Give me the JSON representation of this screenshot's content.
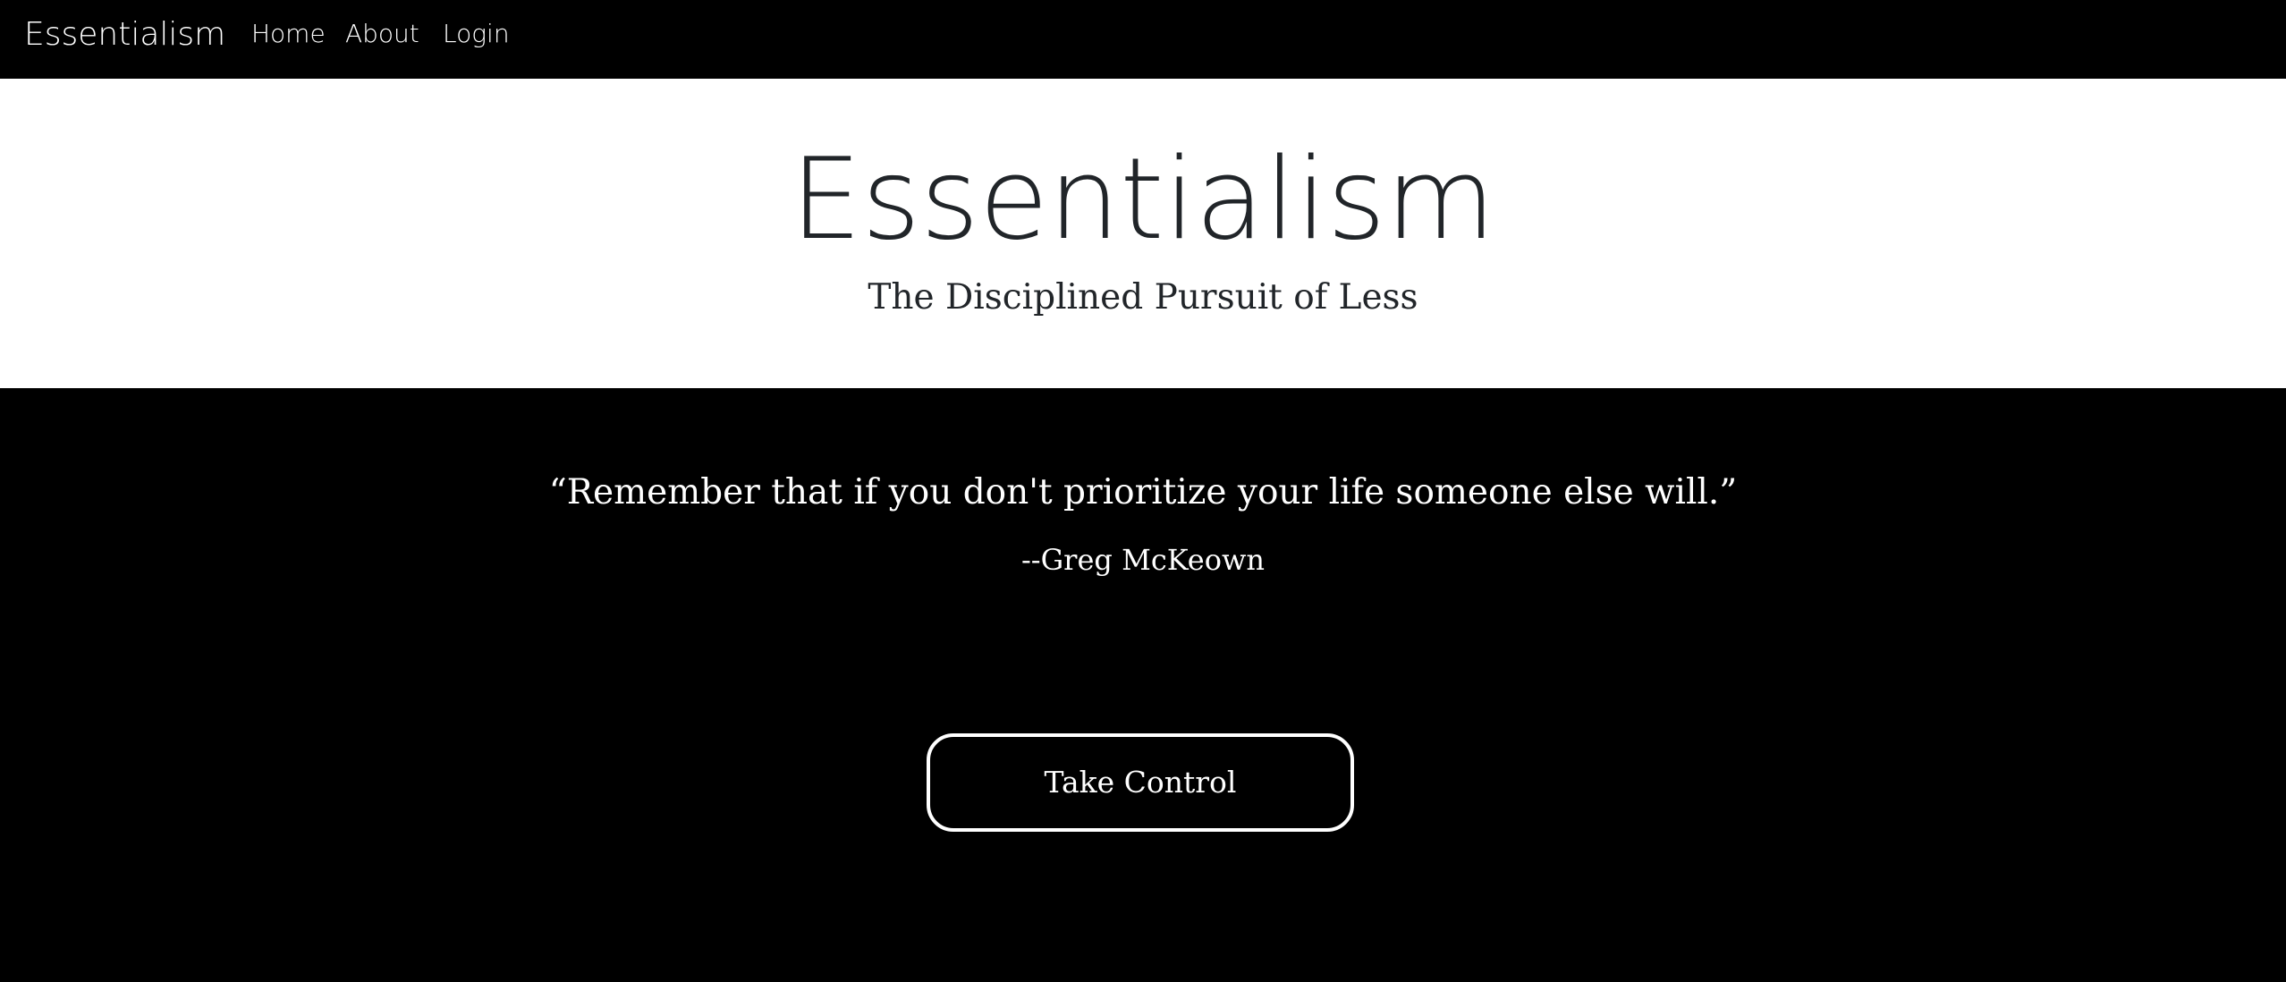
{
  "navbar": {
    "brand": "Essentialism",
    "items": [
      {
        "label": "Home"
      },
      {
        "label": "About"
      },
      {
        "label": "Login"
      }
    ]
  },
  "hero": {
    "title": "Essentialism",
    "subtitle": "The Disciplined Pursuit of Less"
  },
  "quote_section": {
    "quote": "“Remember that if you don't prioritize your life someone else will.”",
    "author": "--Greg McKeown",
    "cta_label": "Take Control"
  },
  "colors": {
    "nav_background": "#000000",
    "hero_background": "#ffffff",
    "hero_text": "#212529",
    "section_background": "#000000",
    "section_text": "#ffffff"
  }
}
